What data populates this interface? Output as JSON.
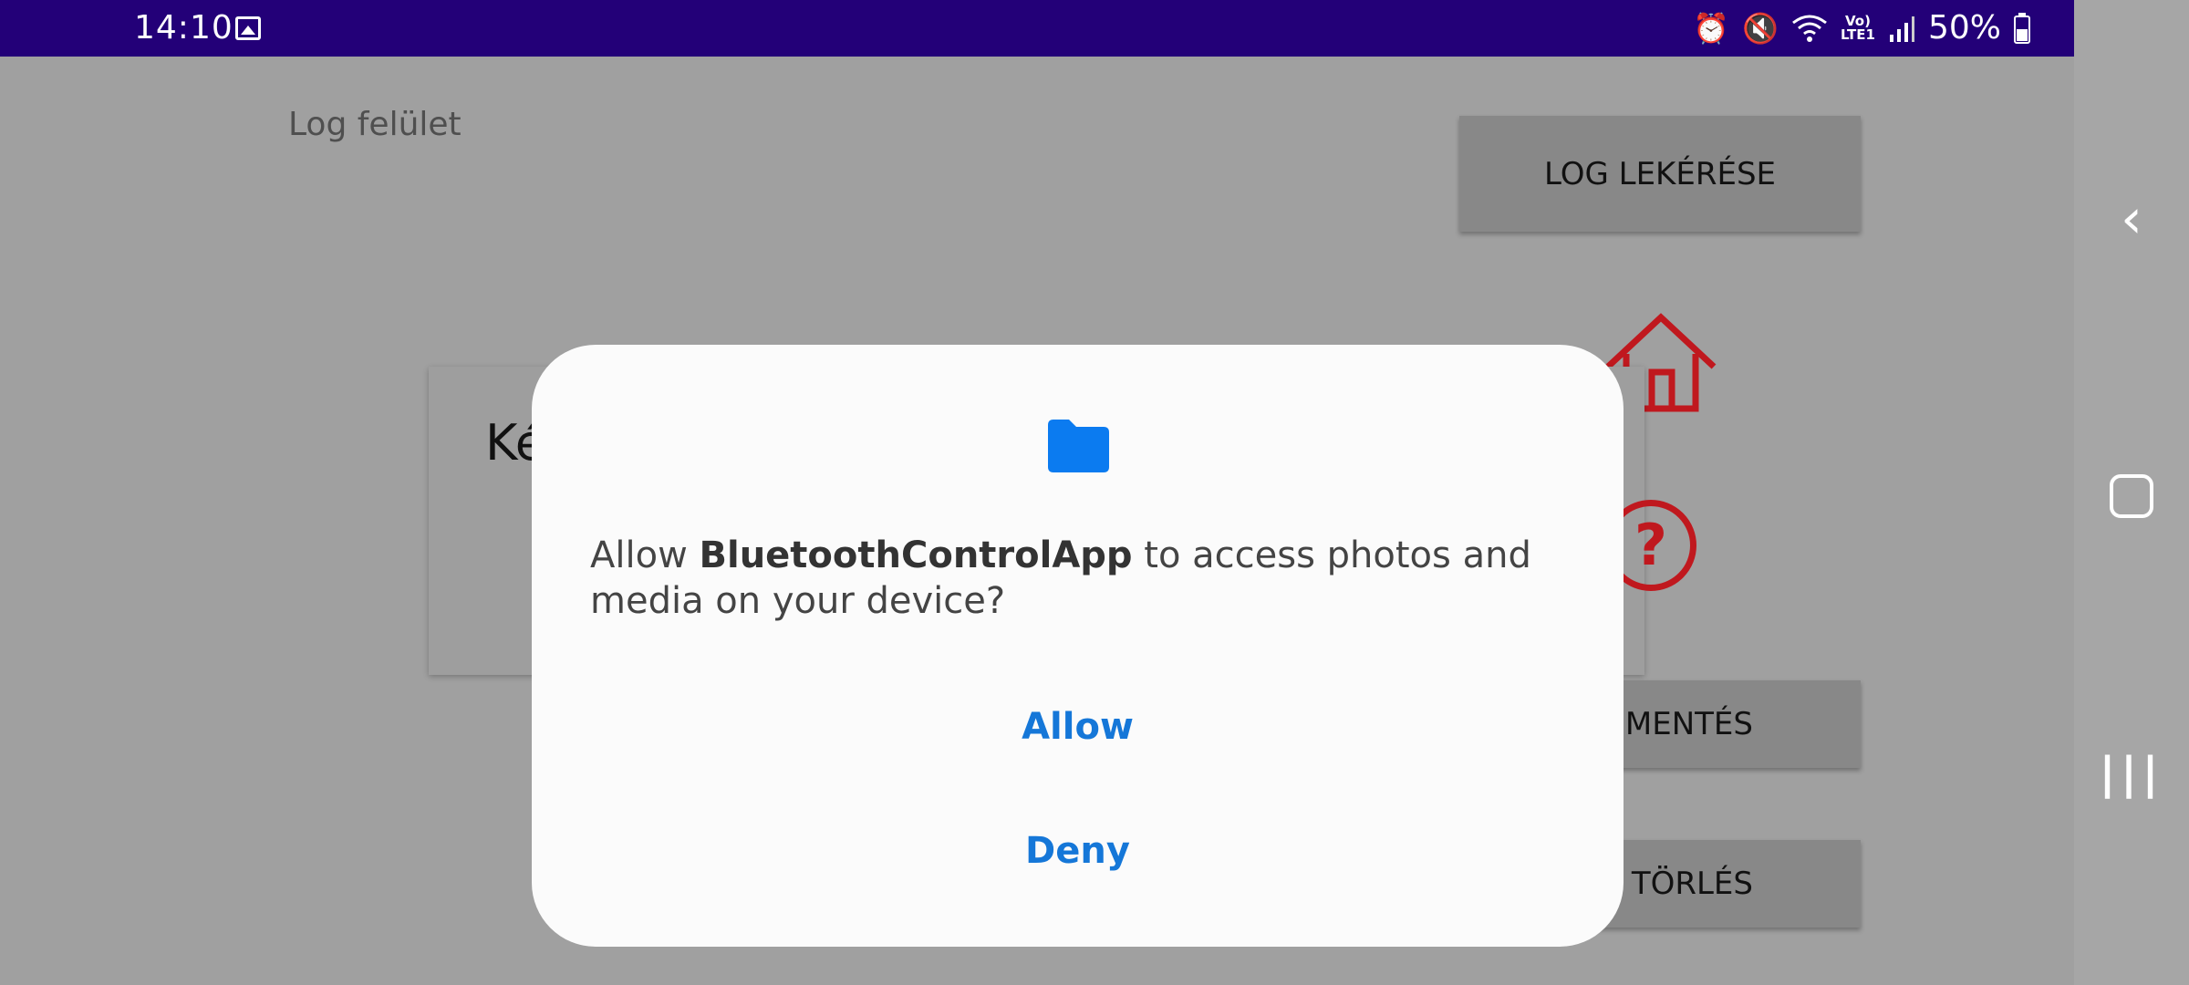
{
  "status_bar": {
    "time": "14:10",
    "battery": "50%",
    "network_label_top": "Vo)",
    "network_label_bottom": "LTE1",
    "icons": [
      "gallery-icon",
      "alarm-icon",
      "mute-icon",
      "wifi-icon",
      "signal-icon",
      "battery-icon"
    ]
  },
  "background_app": {
    "screen_title": "Log felület",
    "log_button": "LOG LEKÉRÉSE",
    "card_text": "Ké",
    "save_button": "MENTÉS",
    "delete_button": "TÖRLÉS",
    "accent_color": "#c0181e"
  },
  "dialog": {
    "msg_before": "Allow ",
    "app_name": "BluetoothControlApp",
    "msg_after": " to access photos and media on your device?",
    "allow_label": "Allow",
    "deny_label": "Deny",
    "accent_color": "#1577d8"
  },
  "nav_bar": {
    "icons": [
      "back-icon",
      "home-icon",
      "recent-apps-icon"
    ]
  }
}
